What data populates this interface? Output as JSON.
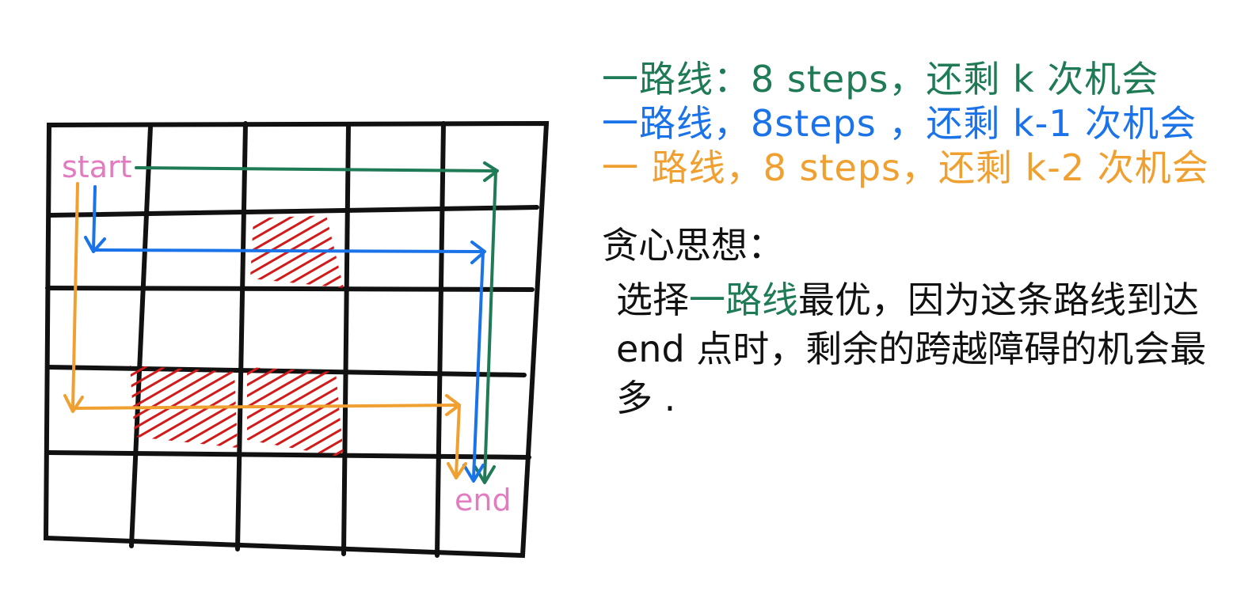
{
  "grid": {
    "start_label": "start",
    "end_label": "end",
    "obstacles": [
      {
        "row": 1,
        "col": 2
      },
      {
        "row": 3,
        "col": 1
      },
      {
        "row": 3,
        "col": 2
      }
    ]
  },
  "colors": {
    "grid": "#111111",
    "green": "#1f7a56",
    "blue": "#1a73e8",
    "orange": "#f0a030",
    "obstacle": "#d11a1a",
    "label": "#e27bbf"
  },
  "routes": [
    {
      "text": "一路线：8 steps，还剩 k 次机会",
      "color": "green"
    },
    {
      "text": "一路线，8steps ，还剩 k-1 次机会",
      "color": "blue"
    },
    {
      "text": "一 路线，8 steps，还剩 k-2 次机会",
      "color": "orange"
    }
  ],
  "greedy": {
    "title": "贪心思想：",
    "body_prefix": "选择",
    "body_highlight": "一路线",
    "body_suffix": "最优，因为这条路线到达 end 点时，剩余的跨越障碍的机会最多 ."
  }
}
